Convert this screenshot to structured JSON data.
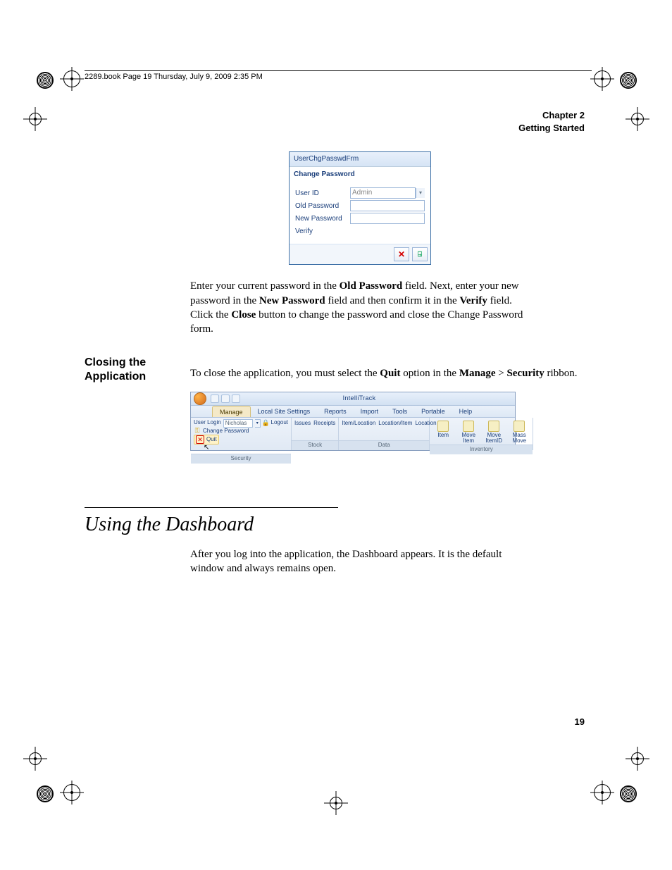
{
  "meta_line": "2289.book  Page 19  Thursday, July 9, 2009  2:35 PM",
  "chapter_line1": "Chapter 2",
  "chapter_line2": "Getting Started",
  "dialog": {
    "title": "UserChgPasswdFrm",
    "subtitle": "Change Password",
    "labels": {
      "userid": "User ID",
      "old": "Old Password",
      "new": "New Password",
      "verify": "Verify"
    },
    "userid_value": "Admin",
    "close_symbol": "✕",
    "exit_symbol": "⍈"
  },
  "para1_pre": "Enter your current password in the ",
  "para1_b1": "Old Password",
  "para1_mid1": " field. Next, enter your new password in the ",
  "para1_b2": "New Password",
  "para1_mid2": " field and then confirm it in the ",
  "para1_b3": "Verify",
  "para1_mid3": " field. Click the ",
  "para1_b4": "Close",
  "para1_end": " button to change the password and close the Change Password form.",
  "sidehead1": "Closing the Application",
  "para2_pre": "To close the application, you must select the ",
  "para2_b1": "Quit",
  "para2_mid1": " option in the ",
  "para2_b2": "Manage",
  "para2_gt": " > ",
  "para2_b3": "Security",
  "para2_end": " ribbon.",
  "ribbon": {
    "app_title": "IntelliTrack",
    "tabs": [
      "Manage",
      "Local Site Settings",
      "Reports",
      "Import",
      "Tools",
      "Portable",
      "Help"
    ],
    "security": {
      "user_login_label": "User Login",
      "user_login_value": "Nicholas",
      "logout": "Logout",
      "change_password": "Change Password",
      "quit": "Quit",
      "group_label": "Security"
    },
    "stock": {
      "issues": "Issues",
      "receipts": "Receipts",
      "group_label": "Stock"
    },
    "data": {
      "item_location": "Item/Location",
      "location_item": "Location/Item",
      "location": "Location",
      "group_label": "Data"
    },
    "inventory": {
      "item": "Item",
      "move_item": "Move Item",
      "move_itemid": "Move ItemID",
      "mass_move": "Mass Move",
      "group_label": "Inventory"
    }
  },
  "section_heading": "Using the Dashboard",
  "para3": "After you log into the application, the Dashboard appears. It is the default window and always remains open.",
  "page_number": "19"
}
